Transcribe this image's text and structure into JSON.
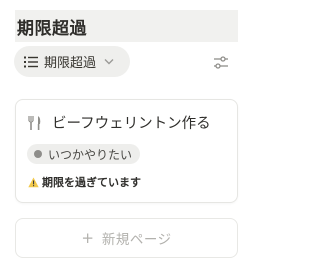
{
  "header": {
    "title": "期限超過"
  },
  "view": {
    "label": "期限超過"
  },
  "card": {
    "title": "ビーフウェリントン作る",
    "tag": "いつかやりたい",
    "warning": "期限を過ぎています"
  },
  "new_page": {
    "plus": "+",
    "label": "新規ページ"
  },
  "colors": {
    "title_bar_bg": "#f1f1ef",
    "pill_bg": "#efefed",
    "tag_bg": "#eeeeec",
    "warning_icon": "#f2c94c",
    "muted_text": "#b2b1ad"
  },
  "icons": {
    "view": "list-icon",
    "dropdown": "chevron-down-icon",
    "filter": "sliders-icon",
    "card": "fork-knife-icon",
    "warning": "warning-icon"
  }
}
